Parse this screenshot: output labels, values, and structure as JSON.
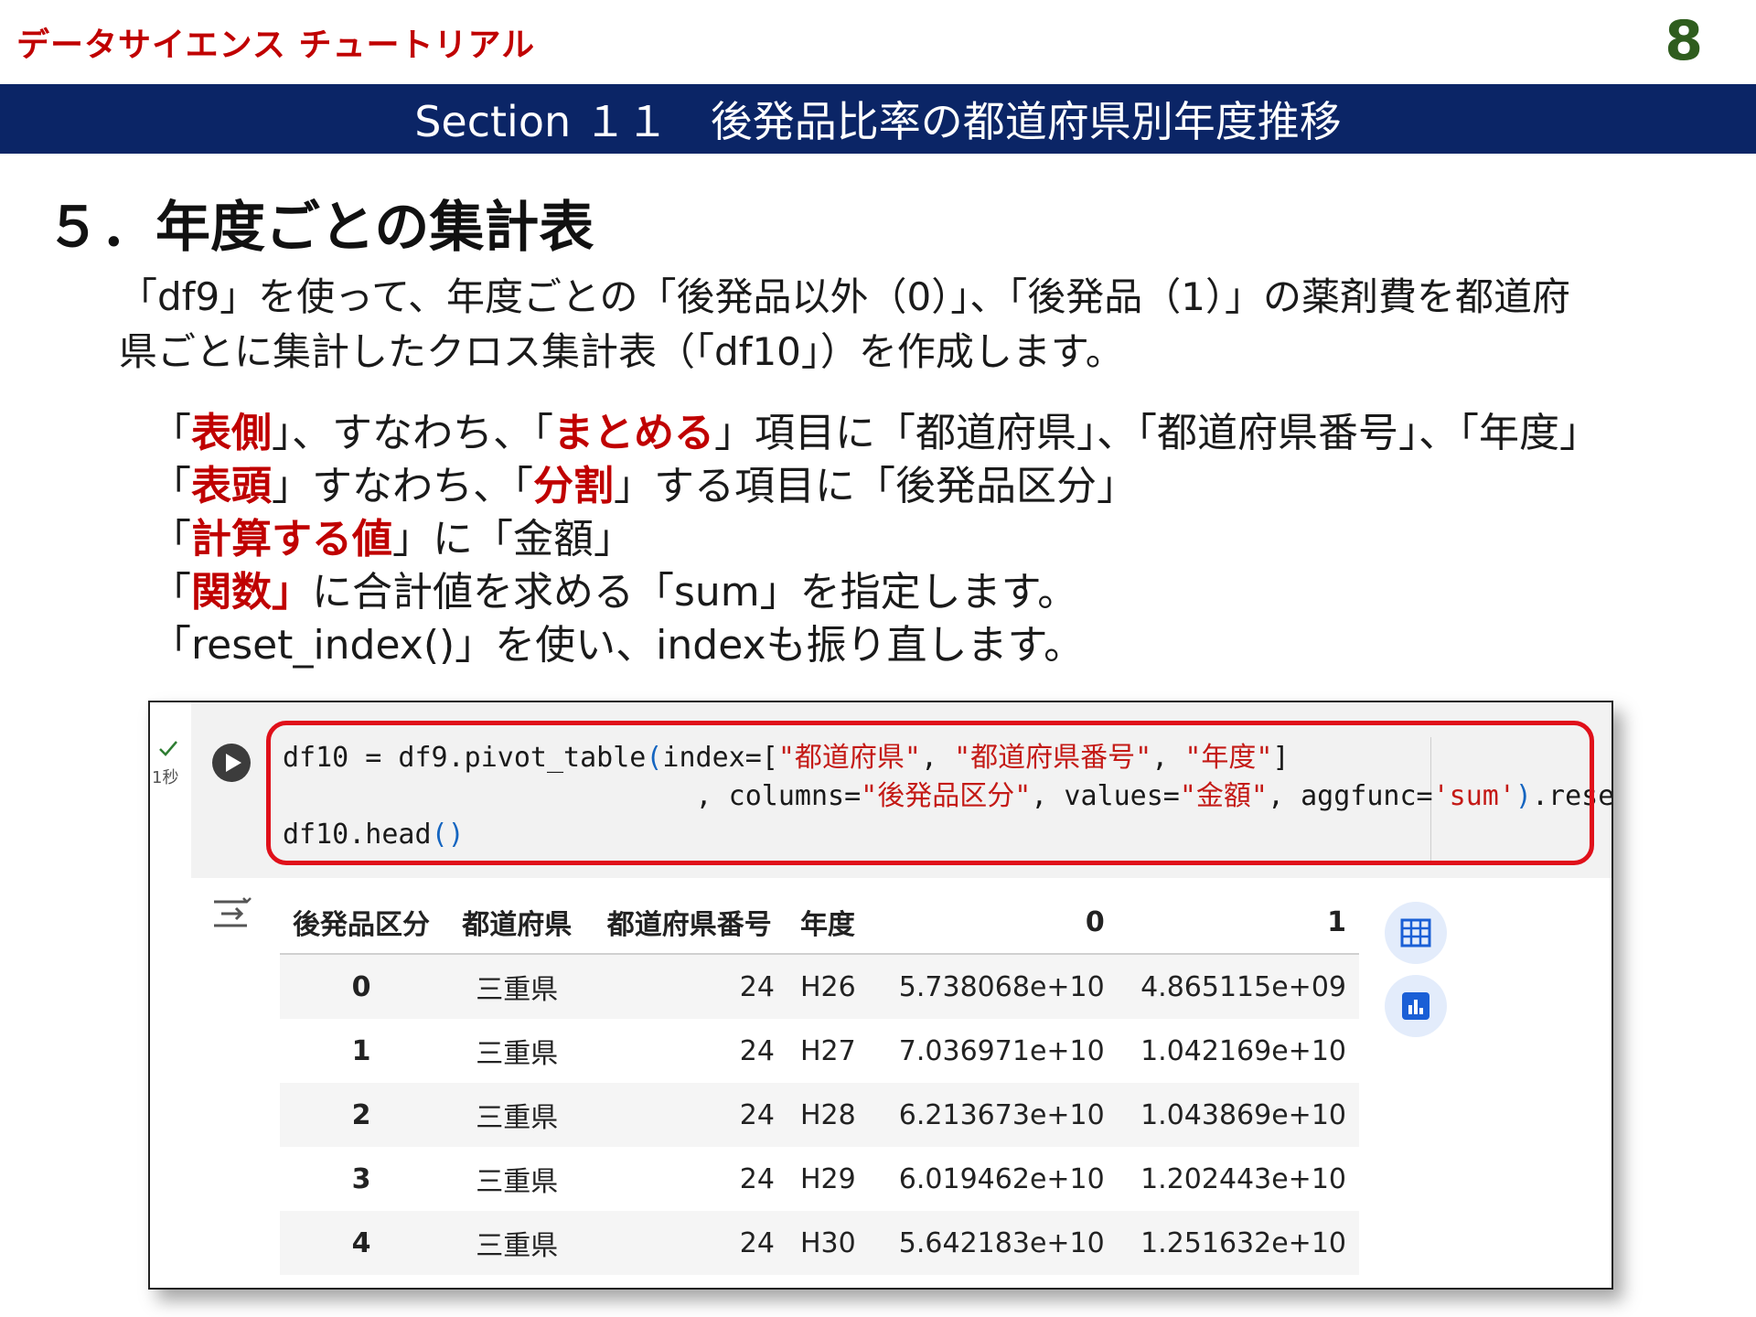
{
  "header": {
    "brand": "データサイエンス チュートリアル",
    "page_number": "8",
    "section_title": "Section １１　後発品比率の都道府県別年度推移"
  },
  "heading": "５．年度ごとの集計表",
  "intro": {
    "line1": "「df9」を使って、年度ごとの「後発品以外（0）」、「後発品（1）」の薬剤費を都道府",
    "line2": "県ごとに集計したクロス集計表（「df10」）を作成します。"
  },
  "bullets": [
    {
      "pre": "「",
      "hl": "表側",
      "mid": "」、すなわち、「",
      "hl2": "まとめる",
      "post": "」項目に「都道府県」、「都道府県番号」、「年度」"
    },
    {
      "pre": "「",
      "hl": "表頭",
      "mid": "」すなわち、「",
      "hl2": "分割",
      "post": "」する項目に「後発品区分」"
    },
    {
      "pre": "「",
      "hl": "計算する値",
      "mid": "」に「金額」",
      "hl2": "",
      "post": ""
    },
    {
      "pre": "「",
      "hl": "関数」",
      "mid": "に合計値を求める「sum」を指定します。",
      "hl2": "",
      "post": ""
    },
    {
      "pre": "「reset_index()」を使い、indexも振り直します。",
      "hl": "",
      "mid": "",
      "hl2": "",
      "post": ""
    }
  ],
  "notebook": {
    "exec_time": "1秒",
    "code": {
      "l1_a": "df10 = df9.pivot_table",
      "l1_b": "(",
      "l1_c": "index=[",
      "l1_s1": "\"都道府県\"",
      "l1_d": ", ",
      "l1_s2": "\"都道府県番号\"",
      "l1_e": ", ",
      "l1_s3": "\"年度\"",
      "l1_f": "]",
      "l2_a": "                         , columns=",
      "l2_s1": "\"後発品区分\"",
      "l2_b": ", values=",
      "l2_s2": "\"金額\"",
      "l2_c": ", aggfunc=",
      "l2_s3": "'sum'",
      "l2_d": ")",
      "l2_e": ".reset_index",
      "l2_f": "()",
      "l3_a": "df10.head",
      "l3_b": "()"
    },
    "table": {
      "headers": [
        "後発品区分",
        "都道府県",
        "都道府県番号",
        "年度",
        "0",
        "1"
      ],
      "rows": [
        [
          "0",
          "三重県",
          "24",
          "H26",
          "5.738068e+10",
          "4.865115e+09"
        ],
        [
          "1",
          "三重県",
          "24",
          "H27",
          "7.036971e+10",
          "1.042169e+10"
        ],
        [
          "2",
          "三重県",
          "24",
          "H28",
          "6.213673e+10",
          "1.043869e+10"
        ],
        [
          "3",
          "三重県",
          "24",
          "H29",
          "6.019462e+10",
          "1.202443e+10"
        ],
        [
          "4",
          "三重県",
          "24",
          "H30",
          "5.642183e+10",
          "1.251632e+10"
        ]
      ]
    }
  },
  "colors": {
    "section_bar": "#0b2566",
    "highlight": "#c00000",
    "code_box_border": "#e0101a",
    "page_number": "#2f5d1e"
  },
  "icons": [
    "check-icon",
    "run-icon",
    "output-toggle-icon",
    "table-icon",
    "chart-icon"
  ]
}
